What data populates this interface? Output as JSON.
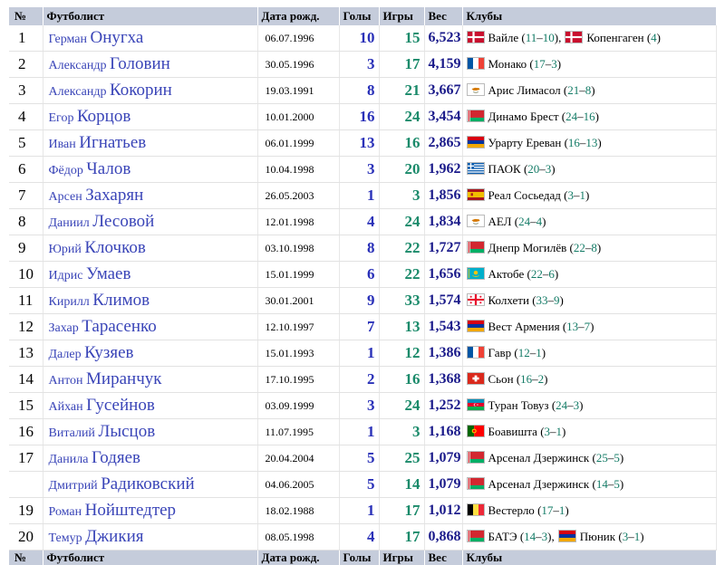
{
  "header": {
    "num": "№",
    "player": "Футболист",
    "birth": "Дата рожд.",
    "goals": "Голы",
    "games": "Игры",
    "weight": "Вес",
    "clubs": "Клубы"
  },
  "rows": [
    {
      "num": "1",
      "first": "Герман",
      "last": "Онугха",
      "birth": "06.07.1996",
      "goals": "10",
      "games": "15",
      "weight": "6,523",
      "clubs": [
        {
          "flag": "denmark",
          "name": "Вайле",
          "a": "11",
          "b": "10"
        },
        {
          "flag": "denmark",
          "name": "Копенгаген",
          "a": "4",
          "b": ""
        }
      ]
    },
    {
      "num": "2",
      "first": "Александр",
      "last": "Головин",
      "birth": "30.05.1996",
      "goals": "3",
      "games": "17",
      "weight": "4,159",
      "clubs": [
        {
          "flag": "france",
          "name": "Монако",
          "a": "17",
          "b": "3"
        }
      ]
    },
    {
      "num": "3",
      "first": "Александр",
      "last": "Кокорин",
      "birth": "19.03.1991",
      "goals": "8",
      "games": "21",
      "weight": "3,667",
      "clubs": [
        {
          "flag": "cyprus",
          "name": "Арис Лимасол",
          "a": "21",
          "b": "8"
        }
      ]
    },
    {
      "num": "4",
      "first": "Егор",
      "last": "Корцов",
      "birth": "10.01.2000",
      "goals": "16",
      "games": "24",
      "weight": "3,454",
      "clubs": [
        {
          "flag": "belarus",
          "name": "Динамо Брест",
          "a": "24",
          "b": "16"
        }
      ]
    },
    {
      "num": "5",
      "first": "Иван",
      "last": "Игнатьев",
      "birth": "06.01.1999",
      "goals": "13",
      "games": "16",
      "weight": "2,865",
      "clubs": [
        {
          "flag": "armenia",
          "name": "Урарту Ереван",
          "a": "16",
          "b": "13"
        }
      ]
    },
    {
      "num": "6",
      "first": "Фёдор",
      "last": "Чалов",
      "birth": "10.04.1998",
      "goals": "3",
      "games": "20",
      "weight": "1,962",
      "clubs": [
        {
          "flag": "greece",
          "name": "ПАОК",
          "a": "20",
          "b": "3"
        }
      ]
    },
    {
      "num": "7",
      "first": "Арсен",
      "last": "Захарян",
      "birth": "26.05.2003",
      "goals": "1",
      "games": "3",
      "weight": "1,856",
      "clubs": [
        {
          "flag": "spain",
          "name": "Реал Сосьедад",
          "a": "3",
          "b": "1"
        }
      ]
    },
    {
      "num": "8",
      "first": "Даниил",
      "last": "Лесовой",
      "birth": "12.01.1998",
      "goals": "4",
      "games": "24",
      "weight": "1,834",
      "clubs": [
        {
          "flag": "cyprus",
          "name": "АЕЛ",
          "a": "24",
          "b": "4"
        }
      ]
    },
    {
      "num": "9",
      "first": "Юрий",
      "last": "Клочков",
      "birth": "03.10.1998",
      "goals": "8",
      "games": "22",
      "weight": "1,727",
      "clubs": [
        {
          "flag": "belarus",
          "name": "Днепр Могилёв",
          "a": "22",
          "b": "8"
        }
      ]
    },
    {
      "num": "10",
      "first": "Идрис",
      "last": "Умаев",
      "birth": "15.01.1999",
      "goals": "6",
      "games": "22",
      "weight": "1,656",
      "clubs": [
        {
          "flag": "kazakhstan",
          "name": "Актобе",
          "a": "22",
          "b": "6"
        }
      ]
    },
    {
      "num": "11",
      "first": "Кирилл",
      "last": "Климов",
      "birth": "30.01.2001",
      "goals": "9",
      "games": "33",
      "weight": "1,574",
      "clubs": [
        {
          "flag": "georgia",
          "name": "Колхети",
          "a": "33",
          "b": "9"
        }
      ]
    },
    {
      "num": "12",
      "first": "Захар",
      "last": "Тарасенко",
      "birth": "12.10.1997",
      "goals": "7",
      "games": "13",
      "weight": "1,543",
      "clubs": [
        {
          "flag": "armenia",
          "name": "Вест Армения",
          "a": "13",
          "b": "7"
        }
      ]
    },
    {
      "num": "13",
      "first": "Далер",
      "last": "Кузяев",
      "birth": "15.01.1993",
      "goals": "1",
      "games": "12",
      "weight": "1,386",
      "clubs": [
        {
          "flag": "france",
          "name": "Гавр",
          "a": "12",
          "b": "1"
        }
      ]
    },
    {
      "num": "14",
      "first": "Антон",
      "last": "Миранчук",
      "birth": "17.10.1995",
      "goals": "2",
      "games": "16",
      "weight": "1,368",
      "clubs": [
        {
          "flag": "switzerland",
          "name": "Сьон",
          "a": "16",
          "b": "2"
        }
      ]
    },
    {
      "num": "15",
      "first": "Айхан",
      "last": "Гусейнов",
      "birth": "03.09.1999",
      "goals": "3",
      "games": "24",
      "weight": "1,252",
      "clubs": [
        {
          "flag": "azerbaijan",
          "name": "Туран Товуз",
          "a": "24",
          "b": "3"
        }
      ]
    },
    {
      "num": "16",
      "first": "Виталий",
      "last": "Лысцов",
      "birth": "11.07.1995",
      "goals": "1",
      "games": "3",
      "weight": "1,168",
      "clubs": [
        {
          "flag": "portugal",
          "name": "Боавишта",
          "a": "3",
          "b": "1"
        }
      ]
    },
    {
      "num": "17",
      "first": "Данила",
      "last": "Годяев",
      "birth": "20.04.2004",
      "goals": "5",
      "games": "25",
      "weight": "1,079",
      "clubs": [
        {
          "flag": "belarus",
          "name": "Арсенал Дзержинск",
          "a": "25",
          "b": "5"
        }
      ]
    },
    {
      "num": "",
      "first": "Дмитрий",
      "last": "Радиковский",
      "birth": "04.06.2005",
      "goals": "5",
      "games": "14",
      "weight": "1,079",
      "clubs": [
        {
          "flag": "belarus",
          "name": "Арсенал Дзержинск",
          "a": "14",
          "b": "5"
        }
      ]
    },
    {
      "num": "19",
      "first": "Роман",
      "last": "Нойштедтер",
      "birth": "18.02.1988",
      "goals": "1",
      "games": "17",
      "weight": "1,012",
      "clubs": [
        {
          "flag": "belgium",
          "name": "Вестерло",
          "a": "17",
          "b": "1"
        }
      ]
    },
    {
      "num": "20",
      "first": "Темур",
      "last": "Джикия",
      "birth": "08.05.1998",
      "goals": "4",
      "games": "17",
      "weight": "0,868",
      "clubs": [
        {
          "flag": "belarus",
          "name": "БАТЭ",
          "a": "14",
          "b": "3"
        },
        {
          "flag": "armenia",
          "name": "Пюник",
          "a": "3",
          "b": "1"
        }
      ]
    }
  ],
  "colors": {
    "header_bg": "#c5ccdb",
    "name_link": "#3a45b8",
    "goals": "#2930b8",
    "games": "#1a8a6a",
    "weight": "#1a1a8a",
    "club_numbers": "#137b66"
  }
}
